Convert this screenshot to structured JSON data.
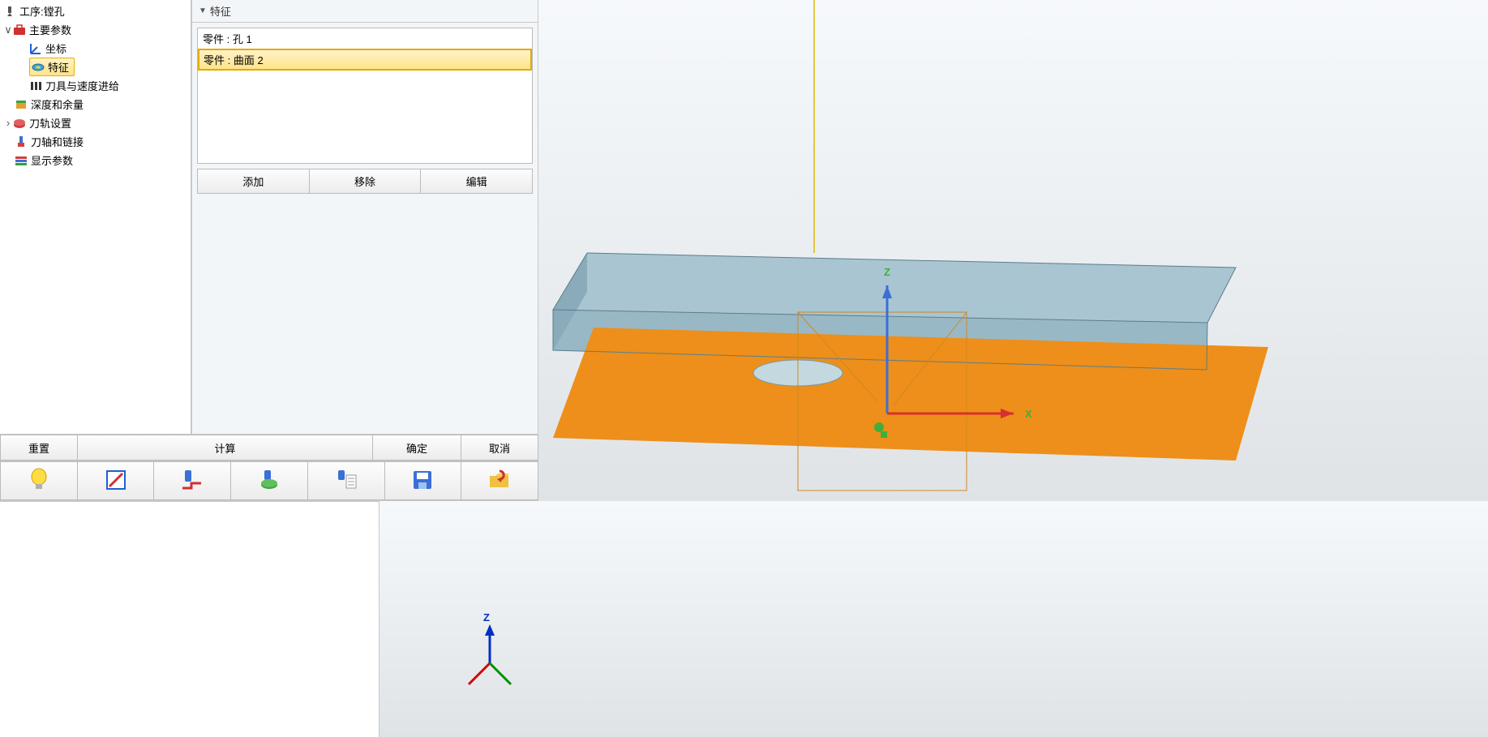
{
  "tree": {
    "root": {
      "label": "工序:镗孔"
    },
    "main_params": {
      "label": "主要参数"
    },
    "coord": {
      "label": "坐标"
    },
    "feature": {
      "label": "特征"
    },
    "tool_feed": {
      "label": "刀具与速度进给"
    },
    "depth_allow": {
      "label": "深度和余量"
    },
    "toolpath_set": {
      "label": "刀轨设置"
    },
    "axis_link": {
      "label": "刀轴和链接"
    },
    "display_params": {
      "label": "显示参数"
    }
  },
  "panel": {
    "feature_header": "特征",
    "items": {
      "0": "零件 : 孔 1",
      "1": "零件 : 曲面 2"
    },
    "add": "添加",
    "remove": "移除",
    "edit": "编辑"
  },
  "buttons": {
    "reset": "重置",
    "calc": "计算",
    "ok": "确定",
    "cancel": "取消"
  },
  "viewport": {
    "axis_z_label": "Z",
    "axis_z_small": "Z",
    "axis_x_small": "X"
  },
  "icons": {
    "bulb": "bulb-icon",
    "note": "note-icon",
    "path1": "toolpath-preview-icon",
    "path2": "toolpath-db-icon",
    "path3": "toolpath-list-icon",
    "save": "save-icon",
    "folder": "open-folder-icon"
  }
}
